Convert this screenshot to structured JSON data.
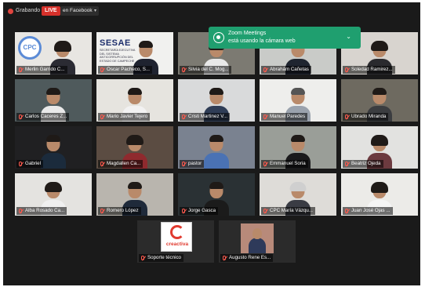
{
  "topbar": {
    "recording_label": "Grabando",
    "live_label": "LIVE",
    "stream_target": "en Facebook",
    "caret": "▾"
  },
  "notification": {
    "title": "Zoom Meetings",
    "text": "está usando la cámara web",
    "chevron": "⌄"
  },
  "logos": {
    "cpc": "CPC",
    "sesa": "SESAE",
    "sesa_sub": "SECRETARÍA EJECUTIVA DEL SISTEMA ANTICORRUPCIÓN DEL ESTADO DE CAMPECHE",
    "creactiva": "creactiva"
  },
  "participants": [
    {
      "name": "Merlin Garrido C..."
    },
    {
      "name": "Oscar Pacheco, S..."
    },
    {
      "name": "Silvia del C. Mog..."
    },
    {
      "name": "Abrahám Cañetas"
    },
    {
      "name": "Soledad Ramirez..."
    },
    {
      "name": "Carlos Caceres Z..."
    },
    {
      "name": "Mario Javier Tejero"
    },
    {
      "name": "Cristi Martinez V..."
    },
    {
      "name": "Manuel Paredes"
    },
    {
      "name": "Ubrado Miranda"
    },
    {
      "name": "Gabriel"
    },
    {
      "name": "Magdallen Ca..."
    },
    {
      "name": "pastor"
    },
    {
      "name": "Emmanuel Soria"
    },
    {
      "name": "Beatriz Ojeda"
    },
    {
      "name": "Alba Rosado Ca..."
    },
    {
      "name": "Romero López"
    },
    {
      "name": "Jorge Gasca"
    },
    {
      "name": "CPC María Vázqu..."
    },
    {
      "name": "Juan José Ojas ..."
    },
    {
      "name": "Soporte técnico"
    },
    {
      "name": "Augusto Rene Es..."
    }
  ]
}
